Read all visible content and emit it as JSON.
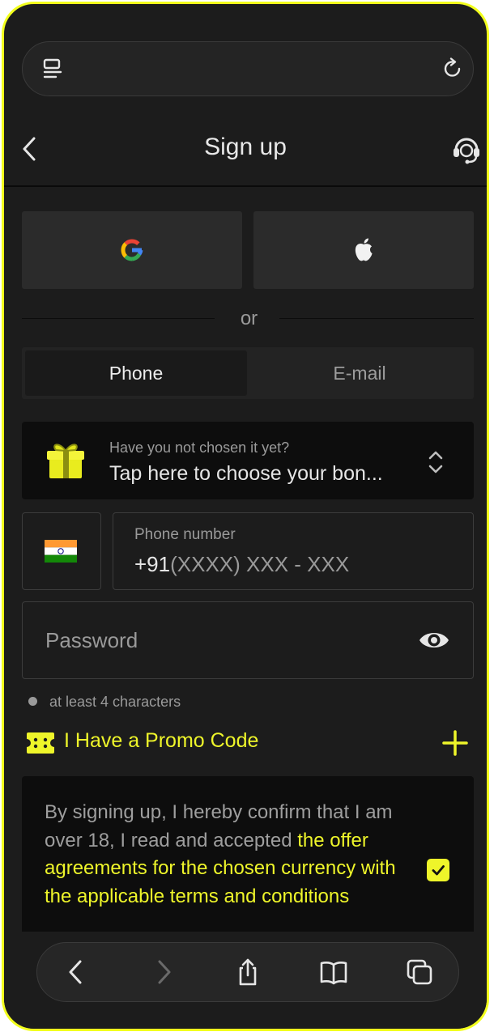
{
  "header": {
    "title": "Sign up"
  },
  "divider": {
    "label": "or"
  },
  "tabs": [
    {
      "label": "Phone",
      "active": true
    },
    {
      "label": "E-mail",
      "active": false
    }
  ],
  "bonus": {
    "subtitle": "Have you not chosen it yet?",
    "main": "Tap here to choose your bon..."
  },
  "phone": {
    "label": "Phone number",
    "prefix": "+91",
    "placeholder": "(XXXX) XXX - XXX",
    "country_flag": "india-flag-icon"
  },
  "password": {
    "placeholder": "Password"
  },
  "password_hint": "at least 4 characters",
  "promo": {
    "label": "I Have a Promo Code"
  },
  "terms": {
    "text_plain": "By signing up, I hereby confirm that I am over 18, I read and accepted ",
    "text_link": "the offer agreements for the chosen currency with the applicable terms and conditions",
    "checked": true
  },
  "colors": {
    "accent": "#eef52a",
    "background": "#1c1c1c",
    "card": "#2b2b2b",
    "frame": "#f2ff1c"
  }
}
